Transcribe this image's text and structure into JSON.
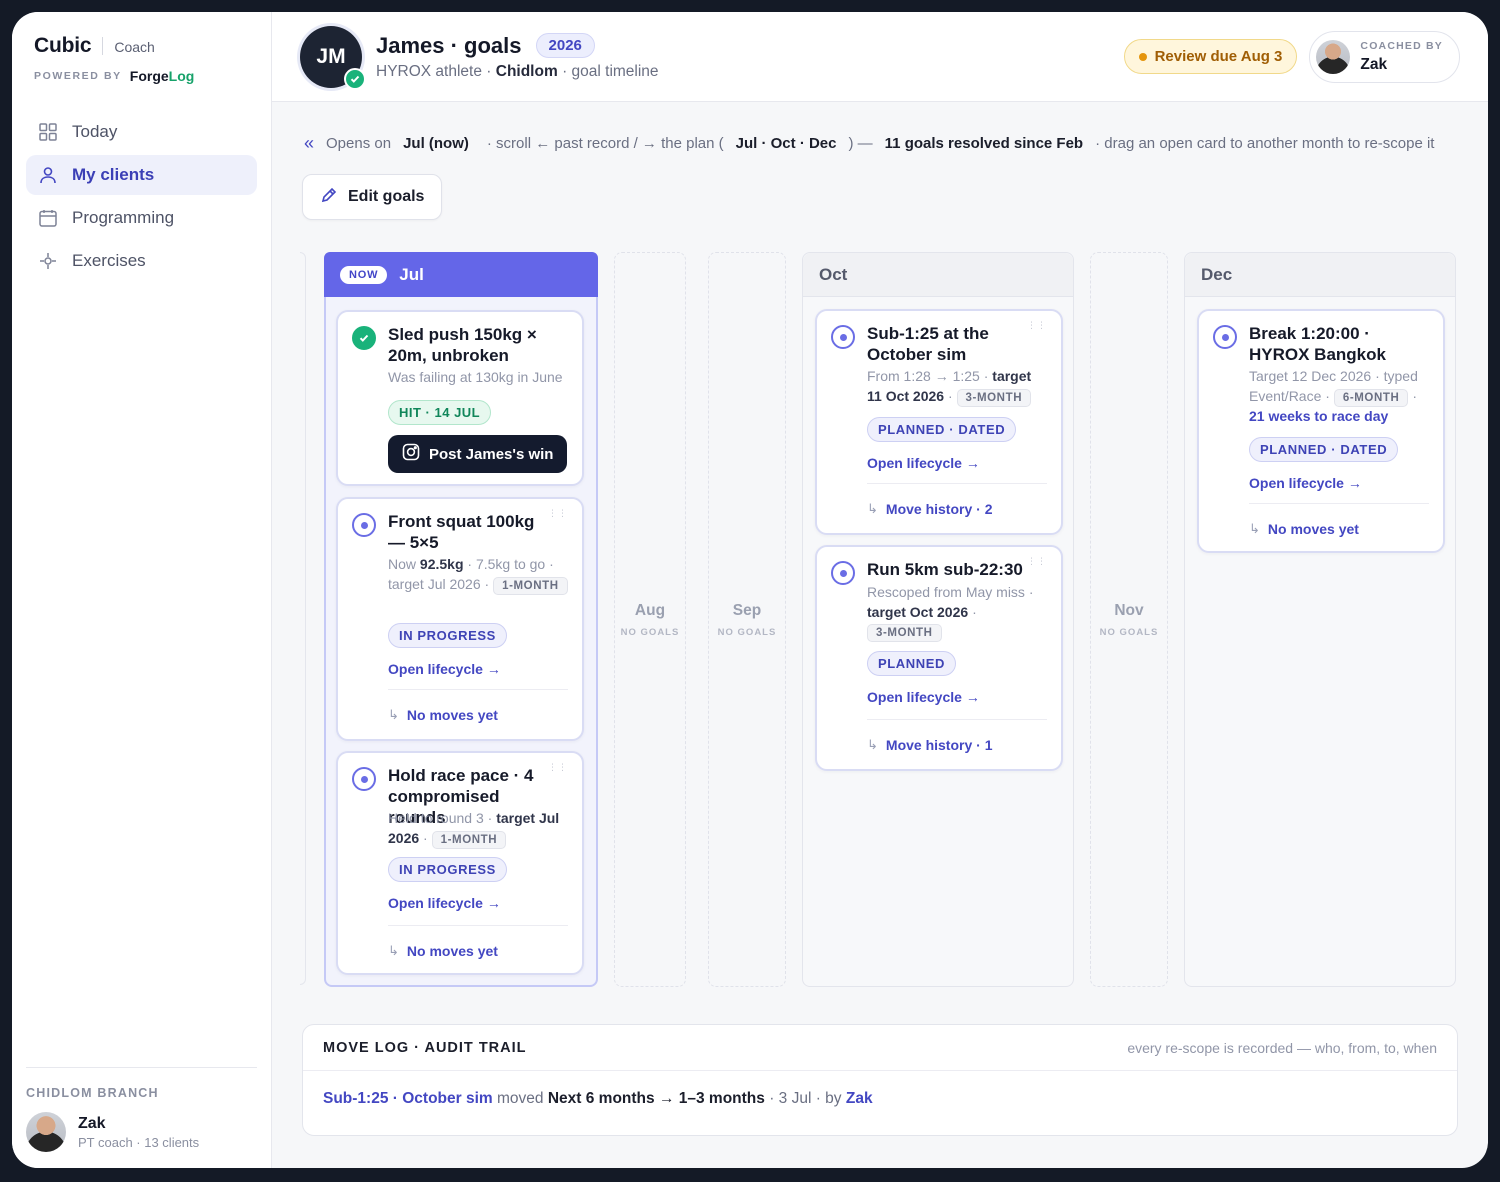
{
  "sidebar": {
    "brand": "Cubic",
    "role": "Coach",
    "powered_label": "POWERED BY",
    "powered_brand_a": "Forge",
    "powered_brand_b": "Log",
    "nav": [
      {
        "label": "Today",
        "icon": "grid-icon"
      },
      {
        "label": "My clients",
        "icon": "user-icon",
        "active": true
      },
      {
        "label": "Programming",
        "icon": "calendar-icon"
      },
      {
        "label": "Exercises",
        "icon": "crosshair-icon"
      }
    ],
    "branch_label": "CHIDLOM BRANCH",
    "coach_name": "Zak",
    "coach_meta": "PT coach · 13 clients"
  },
  "header": {
    "initials": "JM",
    "title": "James · goals",
    "year": "2026",
    "sub_a": "HYROX athlete ·",
    "sub_b": "Chidlom",
    "sub_c": "· goal timeline",
    "review": "Review due Aug 3",
    "coached_label": "COACHED BY",
    "coached_name": "Zak"
  },
  "hint": {
    "opens_on": "Opens on",
    "opens_month": "Jul (now)",
    "scroll": "· scroll ← past record / → the plan (",
    "plan_months": "Jul · Oct · Dec",
    "close": ") —",
    "resolved": "11 goals resolved since Feb",
    "drag": "· drag an open card to another month to re-scope it"
  },
  "edit_goals_label": "Edit goals",
  "columns": {
    "now_badge": "NOW",
    "jul": "Jul",
    "aug": "Aug",
    "sep": "Sep",
    "oct": "Oct",
    "nov": "Nov",
    "dec": "Dec",
    "no_goals": "NO GOALS"
  },
  "cards": {
    "sled": {
      "title": "Sled push 150kg × 20m, unbroken",
      "meta": "Was failing at 130kg in June",
      "hit": "HIT · 14 JUL",
      "post": "Post James's win"
    },
    "squat": {
      "title": "Front squat 100kg — 5×5",
      "now_label": "Now",
      "now_value": "92.5kg",
      "rest": "· 7.5kg to go ·",
      "target": "target Jul 2026",
      "sep": "·",
      "horizon": "1-MONTH",
      "state": "IN PROGRESS",
      "lifecycle": "Open lifecycle →",
      "moves": "No moves yet"
    },
    "race": {
      "title": "Hold race pace · 4 compromised rounds",
      "meta_a": "Held to round 3 ·",
      "target_a": "target Jul",
      "target_b": "2026",
      "sep": "·",
      "horizon": "1-MONTH",
      "state": "IN PROGRESS",
      "lifecycle": "Open lifecycle →",
      "moves": "No moves yet"
    },
    "sim": {
      "title": "Sub-1:25 at the October sim",
      "meta_a": "From 1:28 → 1:25 ·",
      "target_a": "target 11",
      "target_b": "Oct 2026",
      "sep": "·",
      "horizon": "3-MONTH",
      "state": "PLANNED · DATED",
      "lifecycle": "Open lifecycle →",
      "moves": "Move history · 2"
    },
    "run": {
      "title": "Run 5km sub-22:30",
      "meta_a": "Rescoped from May miss ·",
      "target": "target Oct 2026",
      "sep": "·",
      "horizon": "3-MONTH",
      "state": "PLANNED",
      "lifecycle": "Open lifecycle →",
      "moves": "Move history · 1"
    },
    "hyrox": {
      "title": "Break 1:20:00 · HYROX Bangkok",
      "meta_a": "Target 12 Dec 2026 · typed",
      "meta_b": "Event/Race ·",
      "horizon": "6-MONTH",
      "sep": "·",
      "countdown": "21 weeks to race day",
      "state": "PLANNED · DATED",
      "lifecycle": "Open lifecycle →",
      "moves": "No moves yet"
    }
  },
  "movelog": {
    "title": "MOVE LOG · AUDIT TRAIL",
    "note": "every re-scope is recorded — who, from, to, when",
    "entry": {
      "goal": "Sub-1:25 · October sim",
      "verb": "moved",
      "change": "Next 6 months → 1–3 months",
      "when": "· 3 Jul · by",
      "who": "Zak"
    }
  },
  "colors": {
    "accent": "#6466e8",
    "success": "#19b27a",
    "warning": "#e5950c"
  }
}
